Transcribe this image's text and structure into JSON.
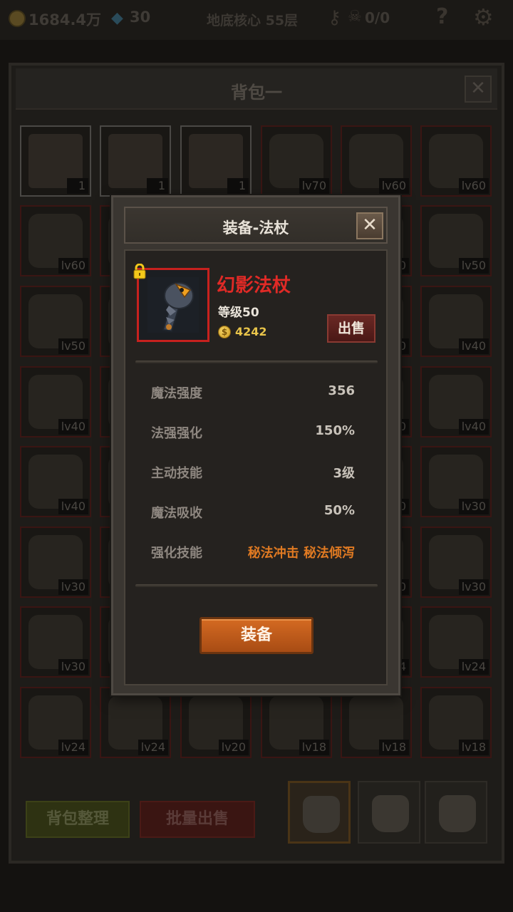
{
  "topbar": {
    "gold": "1684.4万",
    "gems": "30",
    "floor": "地底核心 55层",
    "keys": "0/0",
    "icons": [
      "gold-coin-icon",
      "gem-icon",
      "key-icon",
      "skull-icon",
      "help-icon",
      "gear-icon"
    ]
  },
  "bag": {
    "title": "背包一",
    "close": "✕",
    "slots": [
      {
        "icon": "cake",
        "badge": "1"
      },
      {
        "icon": "cake",
        "badge": "1"
      },
      {
        "icon": "cake",
        "badge": "1"
      },
      {
        "icon": "dagger",
        "badge": "lv70"
      },
      {
        "icon": "axe",
        "badge": "lv60"
      },
      {
        "icon": "trident",
        "badge": "lv60"
      },
      {
        "icon": "amulet",
        "badge": "lv60"
      },
      {
        "icon": "hidden",
        "badge": ""
      },
      {
        "icon": "hidden",
        "badge": ""
      },
      {
        "icon": "hidden",
        "badge": ""
      },
      {
        "icon": "hidden",
        "badge": "0"
      },
      {
        "icon": "orb-staff",
        "badge": "lv50"
      },
      {
        "icon": "ring",
        "badge": "lv50"
      },
      {
        "icon": "hidden",
        "badge": ""
      },
      {
        "icon": "hidden",
        "badge": ""
      },
      {
        "icon": "hidden",
        "badge": ""
      },
      {
        "icon": "hidden",
        "badge": "0"
      },
      {
        "icon": "sword",
        "badge": "lv40"
      },
      {
        "icon": "seed",
        "badge": "lv40"
      },
      {
        "icon": "hidden",
        "badge": ""
      },
      {
        "icon": "hidden",
        "badge": ""
      },
      {
        "icon": "hidden",
        "badge": ""
      },
      {
        "icon": "hidden",
        "badge": "0"
      },
      {
        "icon": "boots",
        "badge": "lv40"
      },
      {
        "icon": "cloak",
        "badge": "lv40"
      },
      {
        "icon": "hidden",
        "badge": ""
      },
      {
        "icon": "hidden",
        "badge": ""
      },
      {
        "icon": "hidden",
        "badge": ""
      },
      {
        "icon": "hidden",
        "badge": "0"
      },
      {
        "icon": "hammer",
        "badge": "lv30"
      },
      {
        "icon": "bow",
        "badge": "lv30"
      },
      {
        "icon": "hidden",
        "badge": ""
      },
      {
        "icon": "hidden",
        "badge": ""
      },
      {
        "icon": "hidden",
        "badge": ""
      },
      {
        "icon": "hidden",
        "badge": "0"
      },
      {
        "icon": "ring",
        "badge": "lv30"
      },
      {
        "icon": "ring",
        "badge": "lv30"
      },
      {
        "icon": "hidden",
        "badge": ""
      },
      {
        "icon": "hidden",
        "badge": ""
      },
      {
        "icon": "hidden",
        "badge": ""
      },
      {
        "icon": "hidden",
        "badge": "4"
      },
      {
        "icon": "gem-ring",
        "badge": "lv24"
      },
      {
        "icon": "boots",
        "badge": "lv24"
      },
      {
        "icon": "helmet",
        "badge": "lv24"
      },
      {
        "icon": "gold-ring",
        "badge": "lv20"
      },
      {
        "icon": "battle-axe",
        "badge": "lv18"
      },
      {
        "icon": "bow",
        "badge": "lv18"
      },
      {
        "icon": "dagger",
        "badge": "lv18"
      }
    ],
    "sort_button": "背包整理",
    "bulk_sell_button": "批量出售",
    "tabs": 3
  },
  "dialog": {
    "title": "装备-法杖",
    "close": "✕",
    "item": {
      "name": "幻影法杖",
      "level": "等级50",
      "price": "4242",
      "coin_symbol": "$",
      "sell_button": "出售",
      "name_color": "#e02a26",
      "locked": true
    },
    "stats": [
      {
        "label": "魔法强度",
        "value": "356"
      },
      {
        "label": "法强强化",
        "value": "150%"
      },
      {
        "label": "主动技能",
        "value": "3级"
      },
      {
        "label": "魔法吸收",
        "value": "50%"
      },
      {
        "label": "强化技能",
        "value": "秘法冲击 秘法倾泻",
        "highlight": "#e07a22"
      }
    ],
    "equip_button": "装备"
  }
}
